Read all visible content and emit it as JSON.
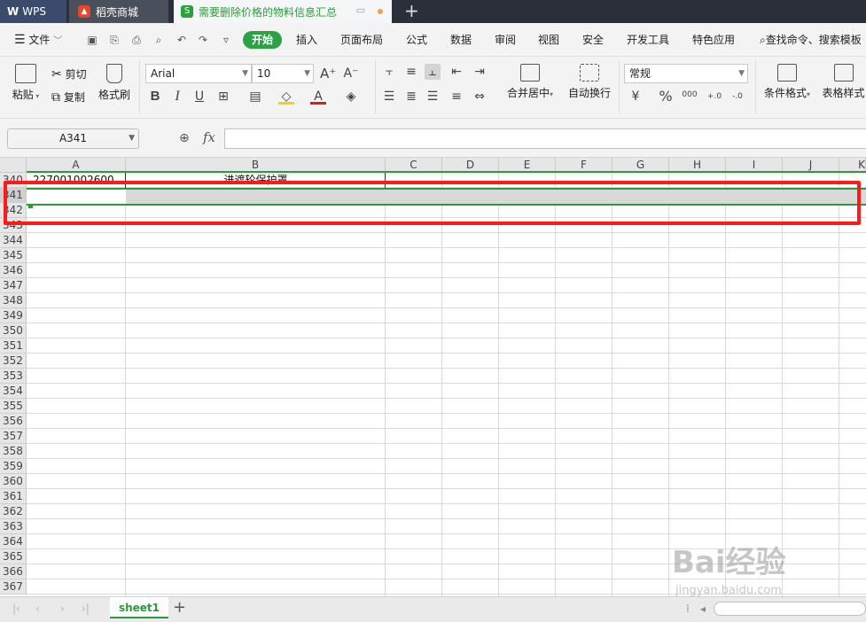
{
  "tabs": {
    "wps": {
      "logo": "W",
      "label": "WPS"
    },
    "shop": {
      "label": "稻壳商城"
    },
    "doc": {
      "label": "需要删除价格的物料信息汇总"
    }
  },
  "menu": {
    "file": "文件",
    "items": [
      "开始",
      "插入",
      "页面布局",
      "公式",
      "数据",
      "审阅",
      "视图",
      "安全",
      "开发工具",
      "特色应用"
    ],
    "search": "查找命令、搜索模板"
  },
  "ribbon": {
    "paste": "粘贴",
    "cut": "剪切",
    "copy": "复制",
    "format_painter": "格式刷",
    "font_name": "Arial",
    "font_size": "10",
    "bold": "B",
    "italic": "I",
    "underline": "U",
    "merge_center": "合并居中",
    "wrap_text": "自动换行",
    "number_format": "常规",
    "percent": "%",
    "thousands": "000",
    "conditional_format": "条件格式",
    "table_style": "表格样式"
  },
  "formula_bar": {
    "name_box": "A341",
    "fx": "fx",
    "formula": ""
  },
  "columns": [
    "A",
    "B",
    "C",
    "D",
    "E",
    "F",
    "G",
    "H",
    "I",
    "J",
    "K"
  ],
  "rows": [
    "340",
    "341",
    "342",
    "343",
    "344",
    "345",
    "346",
    "347",
    "348",
    "349",
    "350",
    "351",
    "352",
    "353",
    "354",
    "355",
    "356",
    "357",
    "358",
    "359",
    "360",
    "361",
    "362",
    "363",
    "364",
    "365",
    "366",
    "367"
  ],
  "cells": {
    "a340": "227001002600",
    "b340": "进遮轮保护罩"
  },
  "sheet": {
    "name": "sheet1",
    "add": "+"
  },
  "watermark": {
    "brand": "Bai经验",
    "url": "jingyan.baidu.com"
  },
  "colors": {
    "accent": "#2ba245",
    "highlight": "#ff1a1a"
  }
}
